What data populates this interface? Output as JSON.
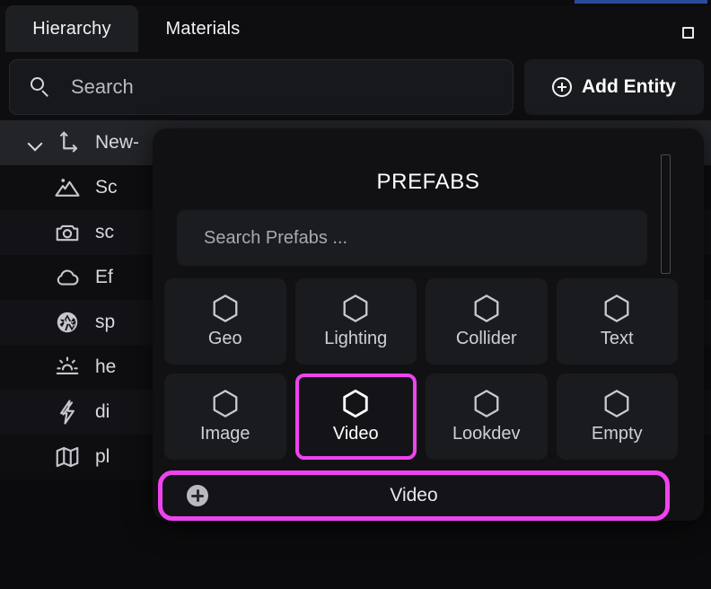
{
  "window": {
    "restore_icon": "square-restore-icon",
    "accent_color": "#2b4c9b"
  },
  "tabs": [
    {
      "label": "Hierarchy",
      "active": true
    },
    {
      "label": "Materials",
      "active": false
    }
  ],
  "toolbar": {
    "search_placeholder": "Search",
    "search_value": "",
    "search_icon": "search-icon",
    "add_entity_label": "Add Entity",
    "add_entity_icon": "plus-circle-icon"
  },
  "hierarchy": {
    "rows": [
      {
        "label": "New-",
        "icon": "axis-gizmo-icon",
        "root": true,
        "expanded": true
      },
      {
        "label": "Sc",
        "icon": "mountains-icon",
        "root": false
      },
      {
        "label": "sc",
        "icon": "camera-icon",
        "root": false
      },
      {
        "label": "Ef",
        "icon": "cloud-icon",
        "root": false
      },
      {
        "label": "sp",
        "icon": "aperture-icon",
        "root": false
      },
      {
        "label": "he",
        "icon": "sunrise-icon",
        "root": false
      },
      {
        "label": "di",
        "icon": "lightning-icon",
        "root": false
      },
      {
        "label": "pl",
        "icon": "map-icon",
        "root": false
      }
    ]
  },
  "prefabs_modal": {
    "title": "PREFABS",
    "search_placeholder": "Search Prefabs ...",
    "search_value": "",
    "scrollbar": "vertical-scrollbar",
    "highlight_color": "#ee44ee",
    "tiles": [
      [
        {
          "label": "Geo",
          "icon": "hexagon-icon",
          "selected": false
        },
        {
          "label": "Lighting",
          "icon": "hexagon-icon",
          "selected": false
        },
        {
          "label": "Collider",
          "icon": "hexagon-icon",
          "selected": false
        },
        {
          "label": "Text",
          "icon": "hexagon-icon",
          "selected": false
        }
      ],
      [
        {
          "label": "Image",
          "icon": "hexagon-icon",
          "selected": false
        },
        {
          "label": "Video",
          "icon": "hexagon-icon",
          "selected": true
        },
        {
          "label": "Lookdev",
          "icon": "hexagon-icon",
          "selected": false
        },
        {
          "label": "Empty",
          "icon": "hexagon-icon",
          "selected": false
        }
      ]
    ],
    "action_bar": {
      "label": "Video",
      "icon": "plus-circle-filled-icon"
    }
  }
}
